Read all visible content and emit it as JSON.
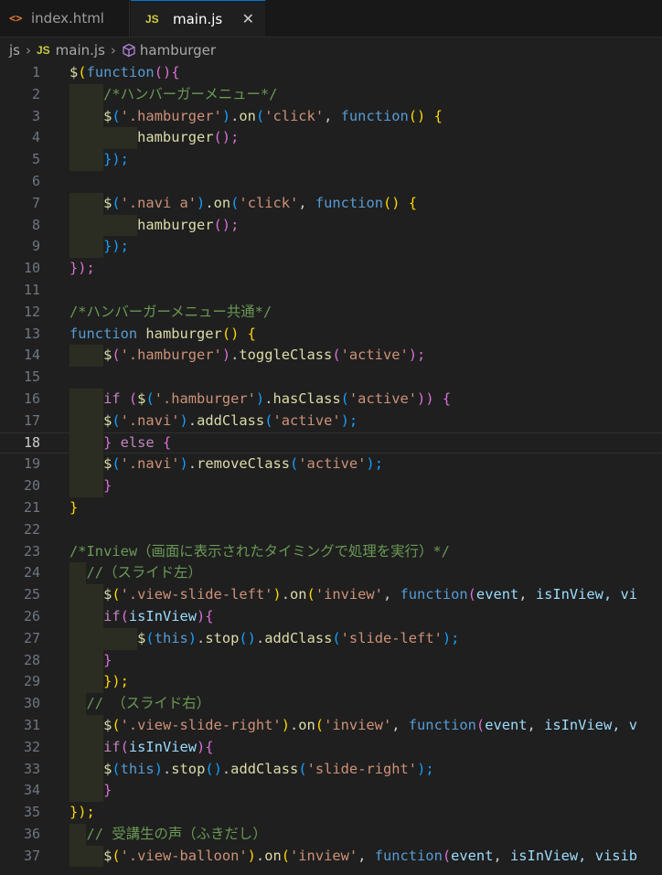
{
  "tabs": [
    {
      "label": "index.html",
      "icon": "html-file-icon",
      "active": false
    },
    {
      "label": "main.js",
      "icon": "js-file-icon",
      "active": true
    }
  ],
  "tab_icon_text": {
    "html": "<>",
    "js": "JS"
  },
  "breadcrumb": {
    "folder": "js",
    "file": "main.js",
    "symbol": "hamburger"
  },
  "colors": {
    "keyword": "#569cd6",
    "function": "#dcdcaa",
    "string": "#ce9178",
    "comment": "#6a9955",
    "bracket1": "#ffd700",
    "bracket2": "#da70d6",
    "bracket3": "#179fff",
    "variable": "#9cdcfe",
    "control": "#c586c0"
  },
  "lines": [
    {
      "n": "1",
      "tokens": [
        [
          "$",
          "fn"
        ],
        [
          "(",
          "b1"
        ],
        [
          "function",
          "kw"
        ],
        [
          "(){",
          "b2"
        ]
      ]
    },
    {
      "n": "2",
      "tokens": [
        [
          "    /*ハンバーガーメニュー*/",
          "cm"
        ]
      ]
    },
    {
      "n": "3",
      "tokens": [
        [
          "    $",
          "fn"
        ],
        [
          "(",
          "b3"
        ],
        [
          "'.hamburger'",
          "str"
        ],
        [
          ")",
          "b3"
        ],
        [
          ".",
          "pl"
        ],
        [
          "on",
          "fn"
        ],
        [
          "(",
          "b3"
        ],
        [
          "'click'",
          "str"
        ],
        [
          ", ",
          "pl"
        ],
        [
          "function",
          "kw"
        ],
        [
          "() ",
          "b1"
        ],
        [
          "{",
          "b1"
        ]
      ]
    },
    {
      "n": "4",
      "tokens": [
        [
          "        hamburger",
          "fn"
        ],
        [
          "();",
          "b2"
        ]
      ]
    },
    {
      "n": "5",
      "tokens": [
        [
          "    ",
          "pl"
        ],
        [
          "});",
          "b3"
        ]
      ]
    },
    {
      "n": "6",
      "tokens": []
    },
    {
      "n": "7",
      "tokens": [
        [
          "    $",
          "fn"
        ],
        [
          "(",
          "b3"
        ],
        [
          "'.navi a'",
          "str"
        ],
        [
          ")",
          "b3"
        ],
        [
          ".",
          "pl"
        ],
        [
          "on",
          "fn"
        ],
        [
          "(",
          "b3"
        ],
        [
          "'click'",
          "str"
        ],
        [
          ", ",
          "pl"
        ],
        [
          "function",
          "kw"
        ],
        [
          "() ",
          "b1"
        ],
        [
          "{",
          "b1"
        ]
      ]
    },
    {
      "n": "8",
      "tokens": [
        [
          "        hamburger",
          "fn"
        ],
        [
          "();",
          "b2"
        ]
      ]
    },
    {
      "n": "9",
      "tokens": [
        [
          "    ",
          "pl"
        ],
        [
          "});",
          "b3"
        ]
      ]
    },
    {
      "n": "10",
      "tokens": [
        [
          "});",
          "b2"
        ]
      ]
    },
    {
      "n": "11",
      "tokens": []
    },
    {
      "n": "12",
      "tokens": [
        [
          "/*ハンバーガーメニュー共通*/",
          "cm"
        ]
      ]
    },
    {
      "n": "13",
      "tokens": [
        [
          "function ",
          "kw"
        ],
        [
          "hamburger",
          "fn"
        ],
        [
          "() {",
          "b1"
        ]
      ]
    },
    {
      "n": "14",
      "tokens": [
        [
          "    $",
          "fn"
        ],
        [
          "(",
          "b2"
        ],
        [
          "'.hamburger'",
          "str"
        ],
        [
          ")",
          "b2"
        ],
        [
          ".",
          "pl"
        ],
        [
          "toggleClass",
          "fn"
        ],
        [
          "(",
          "b2"
        ],
        [
          "'active'",
          "str"
        ],
        [
          ");",
          "b2"
        ]
      ]
    },
    {
      "n": "15",
      "tokens": []
    },
    {
      "n": "16",
      "tokens": [
        [
          "    if ",
          "ctl"
        ],
        [
          "(",
          "b2"
        ],
        [
          "$",
          "fn"
        ],
        [
          "(",
          "b3"
        ],
        [
          "'.hamburger'",
          "str"
        ],
        [
          ")",
          "b3"
        ],
        [
          ".",
          "pl"
        ],
        [
          "hasClass",
          "fn"
        ],
        [
          "(",
          "b3"
        ],
        [
          "'active'",
          "str"
        ],
        [
          "))",
          "b2"
        ],
        [
          " {",
          "b2"
        ]
      ]
    },
    {
      "n": "17",
      "tokens": [
        [
          "    $",
          "fn"
        ],
        [
          "(",
          "b3"
        ],
        [
          "'.navi'",
          "str"
        ],
        [
          ")",
          "b3"
        ],
        [
          ".",
          "pl"
        ],
        [
          "addClass",
          "fn"
        ],
        [
          "(",
          "b3"
        ],
        [
          "'active'",
          "str"
        ],
        [
          ");",
          "b3"
        ]
      ]
    },
    {
      "n": "18",
      "tokens": [
        [
          "    }",
          "b2"
        ],
        [
          " else ",
          "ctl"
        ],
        [
          "{",
          "b2"
        ]
      ]
    },
    {
      "n": "19",
      "tokens": [
        [
          "    $",
          "fn"
        ],
        [
          "(",
          "b3"
        ],
        [
          "'.navi'",
          "str"
        ],
        [
          ")",
          "b3"
        ],
        [
          ".",
          "pl"
        ],
        [
          "removeClass",
          "fn"
        ],
        [
          "(",
          "b3"
        ],
        [
          "'active'",
          "str"
        ],
        [
          ");",
          "b3"
        ]
      ]
    },
    {
      "n": "20",
      "tokens": [
        [
          "    }",
          "b2"
        ]
      ]
    },
    {
      "n": "21",
      "tokens": [
        [
          "}",
          "b1"
        ]
      ]
    },
    {
      "n": "22",
      "tokens": []
    },
    {
      "n": "23",
      "tokens": [
        [
          "/*Inview（画面に表示されたタイミングで処理を実行）*/",
          "cm"
        ]
      ]
    },
    {
      "n": "24",
      "tokens": [
        [
          "  //（スライド左）",
          "cm"
        ]
      ]
    },
    {
      "n": "25",
      "tokens": [
        [
          "    $",
          "fn"
        ],
        [
          "(",
          "b1"
        ],
        [
          "'.view-slide-left'",
          "str"
        ],
        [
          ")",
          "b1"
        ],
        [
          ".",
          "pl"
        ],
        [
          "on",
          "fn"
        ],
        [
          "(",
          "b1"
        ],
        [
          "'inview'",
          "str"
        ],
        [
          ", ",
          "pl"
        ],
        [
          "function",
          "kw"
        ],
        [
          "(",
          "b2"
        ],
        [
          "event",
          "var"
        ],
        [
          ", ",
          "pl"
        ],
        [
          "isInView",
          "var"
        ],
        [
          ", vi",
          "var"
        ]
      ]
    },
    {
      "n": "26",
      "tokens": [
        [
          "    if",
          "ctl"
        ],
        [
          "(",
          "b2"
        ],
        [
          "isInView",
          "var"
        ],
        [
          "){",
          "b2"
        ]
      ]
    },
    {
      "n": "27",
      "tokens": [
        [
          "        $",
          "fn"
        ],
        [
          "(",
          "b3"
        ],
        [
          "this",
          "kw"
        ],
        [
          ")",
          "b3"
        ],
        [
          ".",
          "pl"
        ],
        [
          "stop",
          "fn"
        ],
        [
          "()",
          "b3"
        ],
        [
          ".",
          "pl"
        ],
        [
          "addClass",
          "fn"
        ],
        [
          "(",
          "b3"
        ],
        [
          "'slide-left'",
          "str"
        ],
        [
          ");",
          "b3"
        ]
      ]
    },
    {
      "n": "28",
      "tokens": [
        [
          "    }",
          "b2"
        ]
      ]
    },
    {
      "n": "29",
      "tokens": [
        [
          "    ",
          "pl"
        ],
        [
          "});",
          "b1"
        ]
      ]
    },
    {
      "n": "30",
      "tokens": [
        [
          "  // （スライド右）",
          "cm"
        ]
      ]
    },
    {
      "n": "31",
      "tokens": [
        [
          "    $",
          "fn"
        ],
        [
          "(",
          "b1"
        ],
        [
          "'.view-slide-right'",
          "str"
        ],
        [
          ")",
          "b1"
        ],
        [
          ".",
          "pl"
        ],
        [
          "on",
          "fn"
        ],
        [
          "(",
          "b1"
        ],
        [
          "'inview'",
          "str"
        ],
        [
          ", ",
          "pl"
        ],
        [
          "function",
          "kw"
        ],
        [
          "(",
          "b2"
        ],
        [
          "event",
          "var"
        ],
        [
          ", ",
          "pl"
        ],
        [
          "isInView",
          "var"
        ],
        [
          ", v",
          "var"
        ]
      ]
    },
    {
      "n": "32",
      "tokens": [
        [
          "    if",
          "ctl"
        ],
        [
          "(",
          "b2"
        ],
        [
          "isInView",
          "var"
        ],
        [
          "){",
          "b2"
        ]
      ]
    },
    {
      "n": "33",
      "tokens": [
        [
          "    $",
          "fn"
        ],
        [
          "(",
          "b3"
        ],
        [
          "this",
          "kw"
        ],
        [
          ")",
          "b3"
        ],
        [
          ".",
          "pl"
        ],
        [
          "stop",
          "fn"
        ],
        [
          "()",
          "b3"
        ],
        [
          ".",
          "pl"
        ],
        [
          "addClass",
          "fn"
        ],
        [
          "(",
          "b3"
        ],
        [
          "'slide-right'",
          "str"
        ],
        [
          ");",
          "b3"
        ]
      ]
    },
    {
      "n": "34",
      "tokens": [
        [
          "    }",
          "b2"
        ]
      ]
    },
    {
      "n": "35",
      "tokens": [
        [
          "});",
          "b1"
        ]
      ]
    },
    {
      "n": "36",
      "tokens": [
        [
          "  // 受講生の声（ふきだし）",
          "cm"
        ]
      ]
    },
    {
      "n": "37",
      "tokens": [
        [
          "    $",
          "fn"
        ],
        [
          "(",
          "b1"
        ],
        [
          "'.view-balloon'",
          "str"
        ],
        [
          ")",
          "b1"
        ],
        [
          ".",
          "pl"
        ],
        [
          "on",
          "fn"
        ],
        [
          "(",
          "b1"
        ],
        [
          "'inview'",
          "str"
        ],
        [
          ", ",
          "pl"
        ],
        [
          "function",
          "kw"
        ],
        [
          "(",
          "b2"
        ],
        [
          "event",
          "var"
        ],
        [
          ", ",
          "pl"
        ],
        [
          "isInView",
          "var"
        ],
        [
          ", visib",
          "var"
        ]
      ]
    }
  ]
}
